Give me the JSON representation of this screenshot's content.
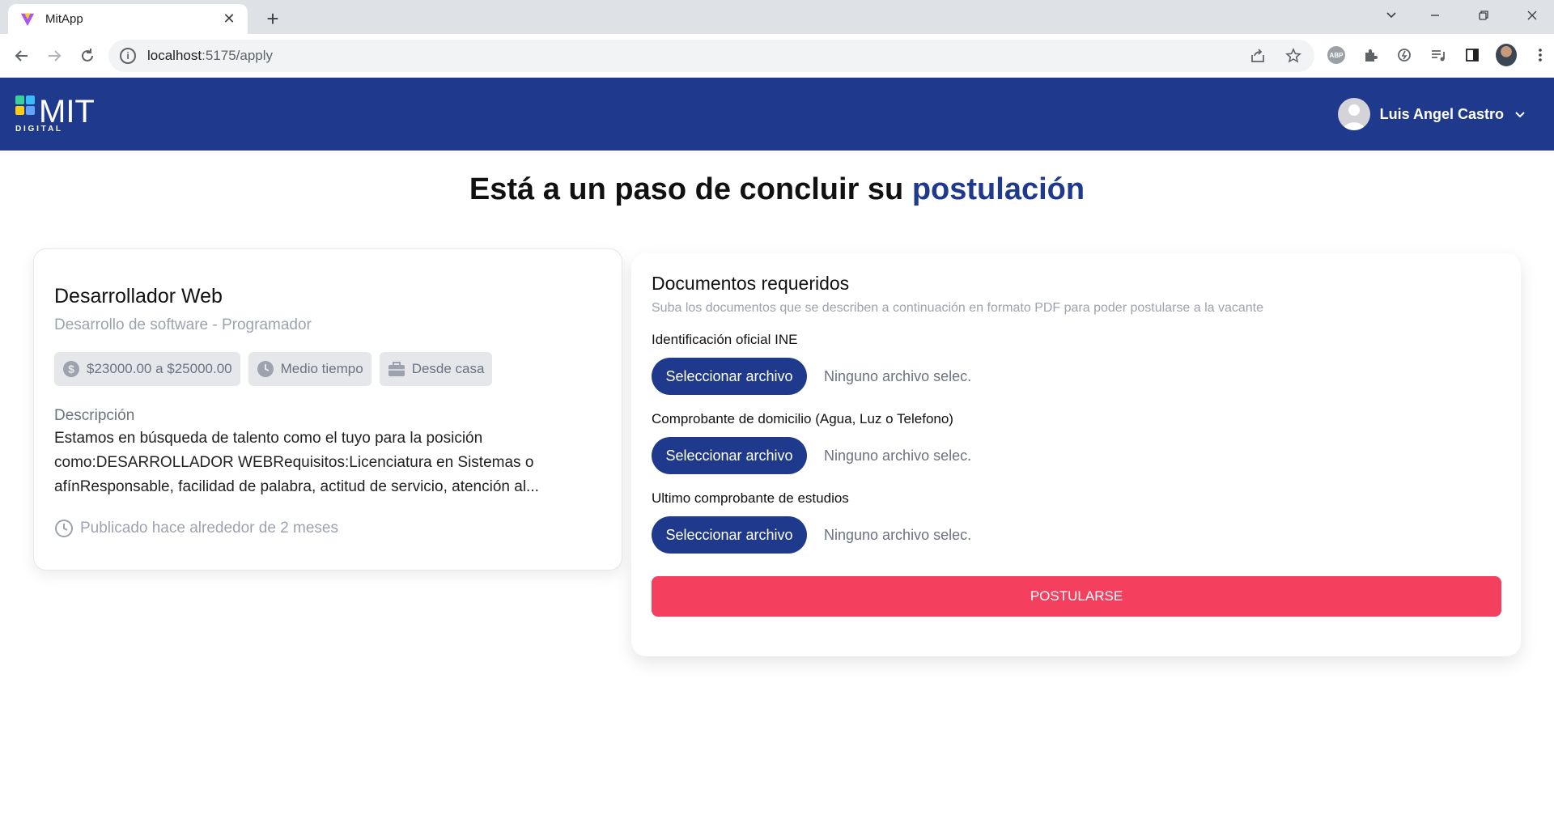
{
  "browser": {
    "tab_title": "MitApp",
    "tab_close": "✕",
    "new_tab": "+",
    "url_host": "localhost",
    "url_rest": ":5175/apply",
    "ext_abp": "ABP"
  },
  "header": {
    "logo_text": "MIT",
    "logo_sub": "D I G I T A L",
    "user_name": "Luis Angel Castro"
  },
  "page": {
    "title_prefix": "Está a un paso de concluir su",
    "title_accent": "postulación"
  },
  "job": {
    "title": "Desarrollador Web",
    "subtitle": "Desarrollo de software - Programador",
    "salary": "$23000.00 a $25000.00",
    "schedule": "Medio tiempo",
    "modality": "Desde casa",
    "description_label": "Descripción",
    "description": "Estamos en búsqueda de talento como el tuyo para la posición como:DESARROLLADOR WEBRequisitos:Licenciatura en Sistemas o afínResponsable, facilidad de palabra, actitud de servicio, atención al...",
    "posted": "Publicado hace alrededor de 2 meses"
  },
  "docs": {
    "title": "Documentos requeridos",
    "subtitle": "Suba los documentos que se describen a continuación en formato PDF para poder postularse a la vacante",
    "items": [
      {
        "label": "Identificación oficial INE",
        "button": "Seleccionar archivo",
        "status": "Ninguno archivo selec."
      },
      {
        "label": "Comprobante de domicilio (Agua, Luz o Telefono)",
        "button": "Seleccionar archivo",
        "status": "Ninguno archivo selec."
      },
      {
        "label": "Ultimo comprobante de estudios",
        "button": "Seleccionar archivo",
        "status": "Ninguno archivo selec."
      }
    ],
    "submit_label": "POSTULARSE"
  },
  "colors": {
    "brand": "#1f3a8c",
    "submit": "#f43f5e"
  }
}
